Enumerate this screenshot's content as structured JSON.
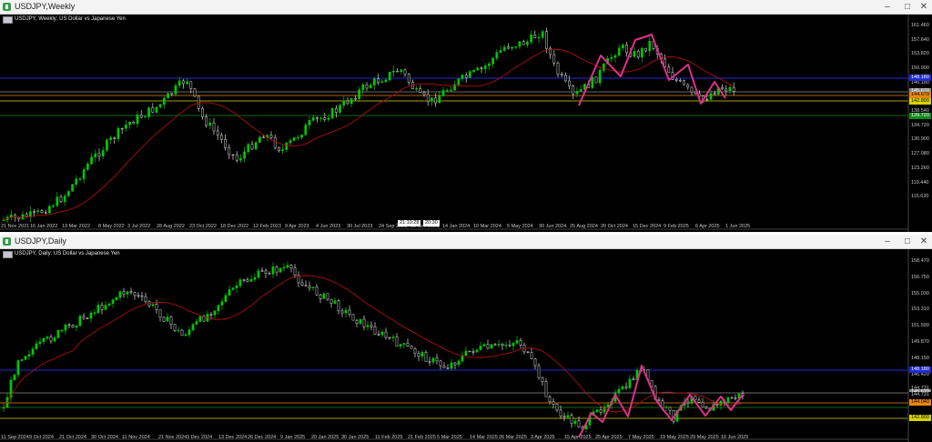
{
  "windows": [
    {
      "title": "USDJPY,Weekly",
      "symbol_desc": "USDJPY, Weekly:  US Dollar vs Japanese Yen",
      "price_axis": [
        "161.460",
        "157.640",
        "153.820",
        "150.000",
        "146.180",
        "142.360",
        "138.540",
        "134.720",
        "130.900",
        "127.080",
        "123.260",
        "119.440",
        "115.620"
      ],
      "date_axis": [
        "21 Nov 2021",
        "16 Jan 2022",
        "13 Mar 2022",
        "8 May 2022",
        "3 Jul 2022",
        "28 Aug 2022",
        "23 Oct 2022",
        "18 Dec 2022",
        "12 Feb 2023",
        "9 Apr 2023",
        "4 Jun 2023",
        "30 Jul 2023",
        "24 Sep 2023",
        "19 Nov 2023",
        "14 Jan 2024",
        "10 Mar 2024",
        "5 May 2024",
        "30 Jun 2024",
        "25 Aug 2024",
        "20 Oct 2024",
        "15 Dec 2024",
        "9 Feb 2025",
        "6 Apr 2025",
        "1 Jun 2025"
      ],
      "time_tags": [
        "21:10:28",
        "20:30"
      ],
      "level_tags": [
        {
          "text": "148.180",
          "bg": "#1f2bd6",
          "fg": "#ffffff"
        },
        {
          "text": "145.670",
          "bg": "#8a8a8a",
          "fg": "#ffffff"
        },
        {
          "text": "144.679",
          "bg": "#e8860c",
          "fg": "#000000"
        },
        {
          "text": "142.800",
          "bg": "#d9d300",
          "fg": "#000000"
        },
        {
          "text": "139.720",
          "bg": "#0f8a1c",
          "fg": "#ffffff"
        }
      ]
    },
    {
      "title": "USDJPY,Daily",
      "symbol_desc": "USDJPY, Daily:  US Dollar vs Japanese Yen",
      "price_axis": [
        "158.470",
        "156.750",
        "155.030",
        "153.310",
        "151.590",
        "149.870",
        "148.150",
        "146.420",
        "144.731",
        "142.990",
        "141.270"
      ],
      "date_axis": [
        "11 Sep 2024",
        "9 Oct 2024",
        "21 Oct 2024",
        "30 Oct 2024",
        "11 Nov 2024",
        "21 Nov 2024",
        "3 Dec 2024",
        "13 Dec 2024",
        "26 Dec 2024",
        "9 Jan 2025",
        "20 Jan 2025",
        "30 Jan 2025",
        "11 Feb 2025",
        "21 Feb 2025",
        "5 Mar 2025",
        "14 Mar 2025",
        "26 Mar 2025",
        "3 Apr 2025",
        "15 Apr 2025",
        "25 Apr 2025",
        "7 May 2025",
        "19 May 2025",
        "29 May 2025",
        "10 Jun 2025"
      ],
      "level_tags": [
        {
          "text": "148.180",
          "bg": "#1f2bd6",
          "fg": "#ffffff"
        },
        {
          "text": "145.670",
          "bg": "#8a8a8a",
          "fg": "#ffffff"
        },
        {
          "text": "144.731",
          "bg": "#000000",
          "fg": "#c8c8c8"
        },
        {
          "text": "144.040",
          "bg": "#e8860c",
          "fg": "#000000"
        },
        {
          "text": "142.800",
          "bg": "#d9d300",
          "fg": "#000000"
        }
      ]
    }
  ],
  "colors": {
    "bull": "#00c800",
    "bear": "#d8d8d8",
    "ma": "#c01010",
    "pattern": "#e0308a",
    "bg": "#000000"
  },
  "icons": {
    "app": "terminal-chart-icon",
    "min": "minimize-icon",
    "max": "maximize-icon",
    "close": "close-icon"
  }
}
